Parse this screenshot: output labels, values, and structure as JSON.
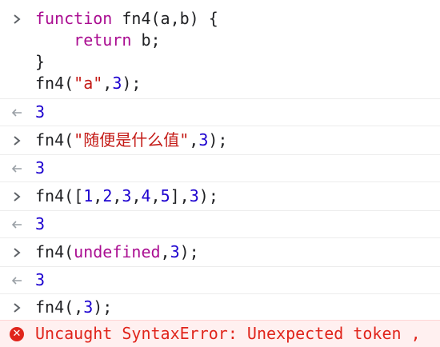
{
  "console": {
    "entry1": {
      "line1": {
        "kw": "function",
        "rest": " fn4(a,b) {"
      },
      "line2": {
        "indent": "    ",
        "kw": "return",
        "rest": " b;"
      },
      "line3": "}",
      "line4": {
        "pre": "fn4(",
        "str": "\"a\"",
        "mid": ",",
        "num": "3",
        "post": ");"
      }
    },
    "result1": "3",
    "entry2": {
      "pre": "fn4(",
      "str": "\"随便是什么值\"",
      "mid": ",",
      "num": "3",
      "post": ");"
    },
    "result2": "3",
    "entry3": {
      "pre": "fn4([",
      "n1": "1",
      "c1": ",",
      "n2": "2",
      "c2": ",",
      "n3": "3",
      "c3": ",",
      "n4": "4",
      "c4": ",",
      "n5": "5",
      "mid": "],",
      "num": "3",
      "post": ");"
    },
    "result3": "3",
    "entry4": {
      "pre": "fn4(",
      "kw": "undefined",
      "mid": ",",
      "num": "3",
      "post": ");"
    },
    "result4": "3",
    "entry5": {
      "pre": "fn4(,",
      "num": "3",
      "post": ");"
    },
    "error": "Uncaught SyntaxError: Unexpected token ,"
  },
  "icons": {
    "input_prompt": "chevron-right-icon",
    "output_prompt": "return-arrow-icon",
    "error": "error-circle-icon"
  },
  "colors": {
    "keyword": "#aa0d91",
    "string": "#c41a16",
    "number": "#1c00cf",
    "error": "#e0241b",
    "error_bg": "#fff0f0"
  }
}
